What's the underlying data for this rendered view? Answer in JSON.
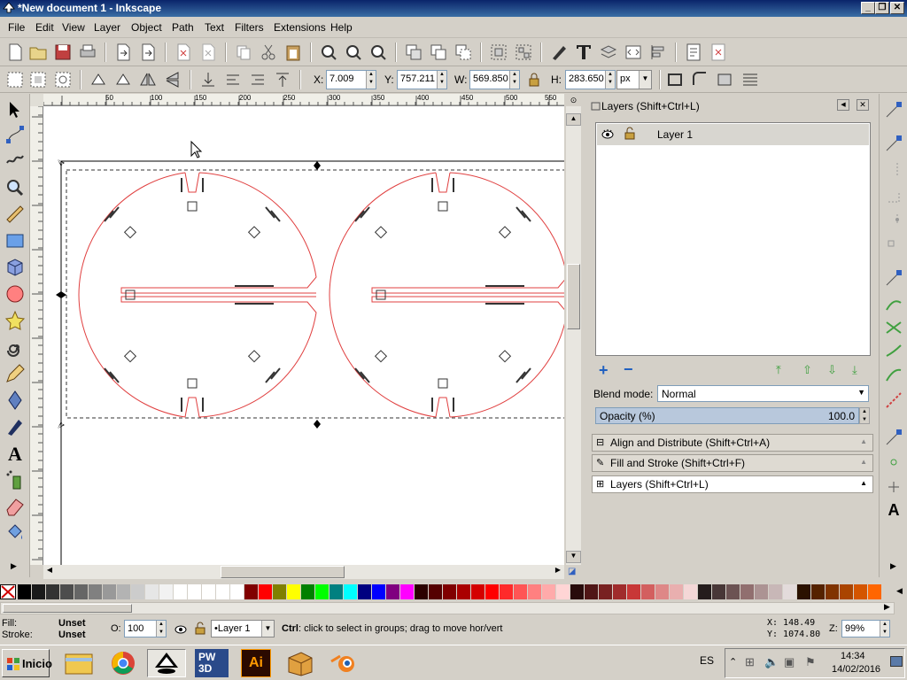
{
  "window": {
    "title": "*New document 1 - Inkscape"
  },
  "menu": [
    "File",
    "Edit",
    "View",
    "Layer",
    "Object",
    "Path",
    "Text",
    "Filters",
    "Extensions",
    "Help"
  ],
  "controls": {
    "x_label": "X:",
    "x_value": "7.009",
    "y_label": "Y:",
    "y_value": "757.211",
    "w_label": "W:",
    "w_value": "569.850",
    "h_label": "H:",
    "h_value": "283.650",
    "unit": "px"
  },
  "ruler_h": [
    "50",
    "100",
    "150",
    "200",
    "250",
    "300",
    "350",
    "400",
    "450",
    "500",
    "550"
  ],
  "ruler_v": [
    "50",
    "100",
    "150",
    "200",
    "250",
    "300",
    "350",
    "400",
    "450",
    "500"
  ],
  "layers_panel": {
    "title": "Layers (Shift+Ctrl+L)",
    "layer_name": "Layer 1",
    "blend_label": "Blend mode:",
    "blend_value": "Normal",
    "opacity_label": "Opacity (%)",
    "opacity_value": "100.0"
  },
  "docked": {
    "align": "Align and Distribute (Shift+Ctrl+A)",
    "fill": "Fill and Stroke (Shift+Ctrl+F)",
    "layers": "Layers (Shift+Ctrl+L)"
  },
  "status": {
    "fill_label": "Fill:",
    "fill_value": "Unset",
    "stroke_label": "Stroke:",
    "stroke_value": "Unset",
    "o_label": "O:",
    "o_value": "100",
    "layer_value": "•Layer 1",
    "message_bold": "Ctrl",
    "message": ": click to select in groups; drag to move hor/vert",
    "x_coord": "X:  148.49",
    "y_coord": "Y: 1074.80",
    "zoom_label": "Z:",
    "zoom_value": "99%"
  },
  "taskbar": {
    "start": "Inicio",
    "lang": "ES",
    "time": "14:34",
    "date": "14/02/2016",
    "apps": [
      "explorer-icon",
      "chrome-icon",
      "inkscape-icon",
      "pw3d-icon",
      "illustrator-icon",
      "archive-icon",
      "blender-icon"
    ],
    "pw3d_text": "PW\n3D",
    "ai_text": "Ai"
  },
  "palette": [
    "#000000",
    "#1a1a1a",
    "#333333",
    "#4d4d4d",
    "#666666",
    "#808080",
    "#999999",
    "#b3b3b3",
    "#cccccc",
    "#e6e6e6",
    "#f2f2f2",
    "#ffffff",
    "#ffffff",
    "#ffffff",
    "#ffffff",
    "#ffffff",
    "#800000",
    "#ff0000",
    "#808000",
    "#ffff00",
    "#008000",
    "#00ff00",
    "#008080",
    "#00ffff",
    "#000080",
    "#0000ff",
    "#800080",
    "#ff00ff",
    "#2b0000",
    "#550000",
    "#800000",
    "#aa0000",
    "#d40000",
    "#ff0000",
    "#ff2a2a",
    "#ff5555",
    "#ff8080",
    "#ffaaaa",
    "#ffd5d5",
    "#280b0b",
    "#501616",
    "#782121",
    "#a02c2c",
    "#c83737",
    "#d35f5f",
    "#de8787",
    "#e9afaf",
    "#f4d7d7",
    "#241c1c",
    "#483737",
    "#6c5353",
    "#916f6f",
    "#ac9393",
    "#c8b7b7",
    "#e3dbdb",
    "#2b1100",
    "#552200",
    "#803300",
    "#aa4400",
    "#d45500",
    "#ff6600"
  ]
}
